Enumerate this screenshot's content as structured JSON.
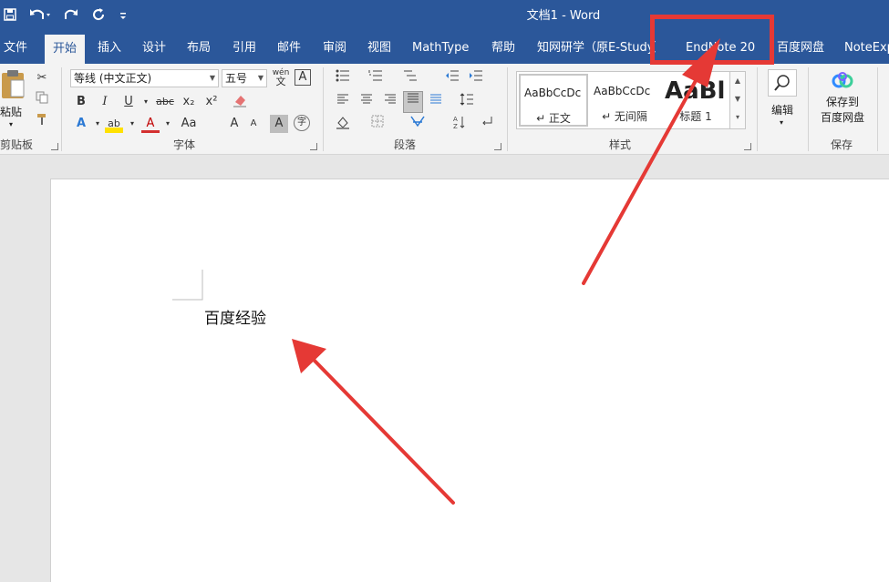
{
  "titlebar": {
    "title": "文档1  -  Word",
    "quick_access": [
      "save-icon",
      "undo-icon",
      "redo-icon",
      "refresh-icon",
      "customize-icon"
    ]
  },
  "tabs": [
    {
      "label": "文件"
    },
    {
      "label": "开始"
    },
    {
      "label": "插入"
    },
    {
      "label": "设计"
    },
    {
      "label": "布局"
    },
    {
      "label": "引用"
    },
    {
      "label": "邮件"
    },
    {
      "label": "审阅"
    },
    {
      "label": "视图"
    },
    {
      "label": "MathType"
    },
    {
      "label": "帮助"
    },
    {
      "label": "知网研学（原E-Study）"
    },
    {
      "label": "EndNote 20"
    },
    {
      "label": "百度网盘"
    },
    {
      "label": "NoteExp"
    }
  ],
  "ribbon": {
    "clipboard": {
      "paste_label": "粘贴",
      "group_label": "剪贴板"
    },
    "font": {
      "font_name": "等线 (中文正文)",
      "font_size": "五号",
      "phonetic_glyph": "wén",
      "border_char": "A",
      "bold": "B",
      "italic": "I",
      "underline": "U",
      "strike": "abc",
      "subscript": "x₂",
      "superscript": "x²",
      "text_effects": "A",
      "highlight": "ab",
      "font_color": "A",
      "change_case": "Aa",
      "grow": "A",
      "shrink": "A",
      "shading_char": "A",
      "enclose_char": "字",
      "group_label": "字体"
    },
    "paragraph": {
      "group_label": "段落"
    },
    "styles": {
      "tiles": [
        {
          "sample": "AaBbCcDc",
          "name": "↵ 正文"
        },
        {
          "sample": "AaBbCcDc",
          "name": "↵ 无间隔"
        },
        {
          "sample": "AaBl",
          "name": "标题 1"
        }
      ],
      "group_label": "样式"
    },
    "editing": {
      "label": "编辑"
    },
    "save": {
      "label_line1": "保存到",
      "label_line2": "百度网盘",
      "group_label": "保存"
    }
  },
  "document": {
    "text": "百度经验"
  },
  "colors": {
    "accent": "#2b579a",
    "annotation": "#e53935"
  }
}
